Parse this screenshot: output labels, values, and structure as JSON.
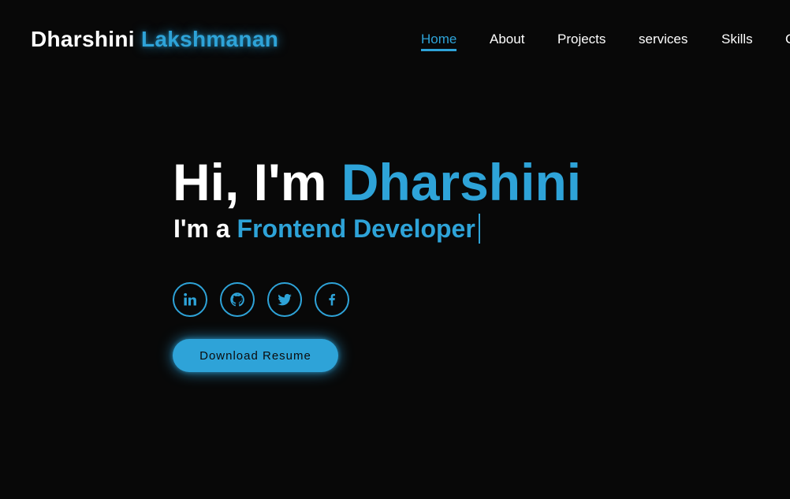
{
  "header": {
    "logo_first": "Dharshini",
    "logo_last": "Lakshmanan",
    "nav": {
      "home": "Home",
      "about": "About",
      "projects": "Projects",
      "services": "services",
      "skills": "Skills",
      "contact": "C"
    },
    "active_item": "Home"
  },
  "hero": {
    "greeting": "Hi, I'm",
    "name": "Dharshini",
    "role_prefix": "I'm a",
    "role": "Frontend Developer"
  },
  "socials": [
    {
      "icon": "linkedin-icon"
    },
    {
      "icon": "github-icon"
    },
    {
      "icon": "twitter-icon"
    },
    {
      "icon": "facebook-icon"
    }
  ],
  "cta": {
    "download_label": "Download Resume"
  },
  "colors": {
    "background": "#080808",
    "accent": "#2ea3d8",
    "text": "#ffffff"
  }
}
